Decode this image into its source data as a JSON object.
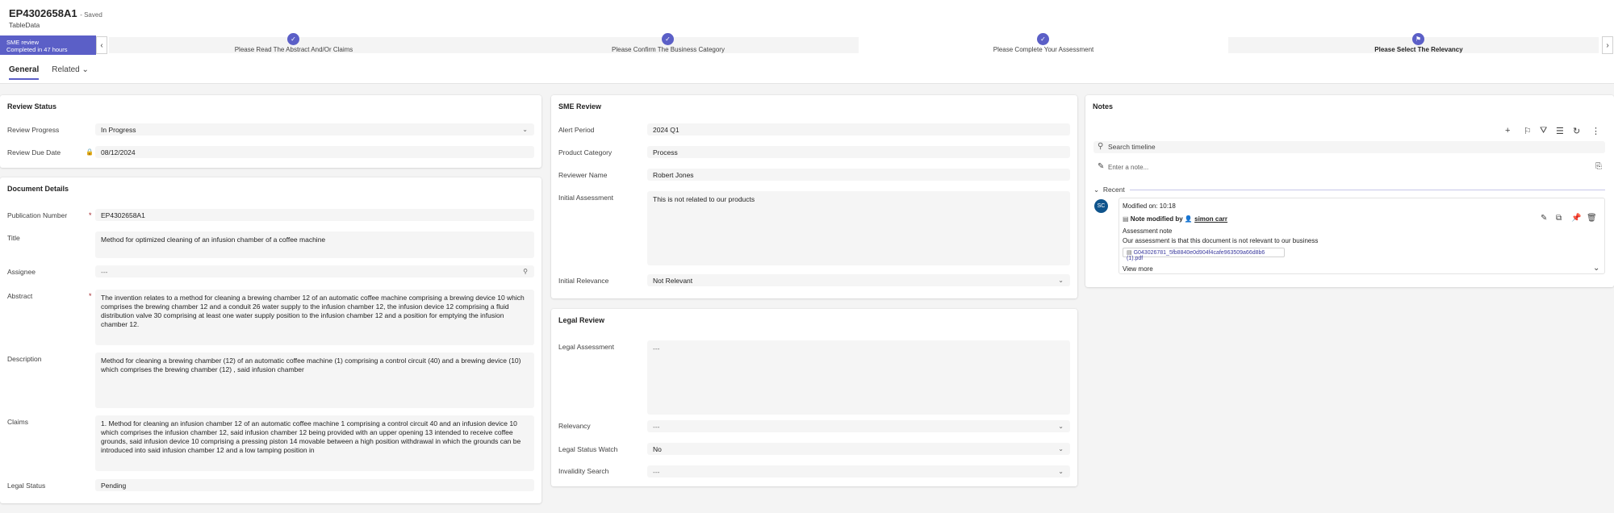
{
  "header": {
    "record_title": "EP4302658A1",
    "save_status": "- Saved",
    "entity_name": "TableData"
  },
  "bpf": {
    "active_stage_name": "SME review",
    "active_stage_duration": "Completed in 47 hours",
    "prev_icon": "chevron-left-icon",
    "next_icon": "chevron-right-icon",
    "stages": [
      {
        "label": "Please Read The Abstract And/Or Claims",
        "status": "completed",
        "icon": "✓"
      },
      {
        "label": "Please Confirm The Business Category",
        "status": "completed",
        "icon": "✓"
      },
      {
        "label": "Please Complete Your Assessment",
        "status": "completed",
        "icon": "✓"
      },
      {
        "label": "Please Select The Relevancy",
        "status": "current",
        "icon": "⚑"
      }
    ]
  },
  "tabs": [
    {
      "label": "General",
      "active": true
    },
    {
      "label": "Related",
      "active": false
    }
  ],
  "review_status": {
    "title": "Review Status",
    "review_progress_label": "Review Progress",
    "review_progress_value": "In Progress",
    "review_due_date_label": "Review Due Date",
    "review_due_date_value": "08/12/2024"
  },
  "document_details": {
    "title": "Document Details",
    "publication_number_label": "Publication Number",
    "publication_number_value": "EP4302658A1",
    "title_label": "Title",
    "title_value": "Method for optimized cleaning of an infusion chamber of a coffee machine",
    "assignee_label": "Assignee",
    "assignee_value": "---",
    "abstract_label": "Abstract",
    "abstract_value": "The invention relates to a method for cleaning a brewing chamber 12 of an automatic coffee machine comprising a brewing device 10 which comprises the brewing chamber 12 and a conduit 26  water supply to the infusion chamber 12, the infusion device 12 comprising a fluid distribution valve 30 comprising at least one water supply position to the infusion chamber   12 and a position for emptying the infusion chamber 12.",
    "description_label": "Description",
    "description_value": "Method for cleaning a brewing chamber (12) of an automatic coffee machine (1) comprising a control circuit (40) and a brewing device (10) which comprises the brewing chamber (12) , said infusion chamber",
    "claims_label": "Claims",
    "claims_value": "1. Method for cleaning an infusion chamber 12 of an automatic coffee machine 1 comprising a control circuit 40 and an infusion device 10 which comprises the infusion chamber   12, said infusion chamber 12 being provided with an upper opening 13 intended to receive coffee grounds, said infusion device 10 comprising a pressing piston 14 movable between a high position  withdrawal in which the grounds can be introduced into said infusion chamber 12 and a low tamping position in",
    "legal_status_label": "Legal Status",
    "legal_status_value": "Pending"
  },
  "sme_review": {
    "title": "SME Review",
    "alert_period_label": "Alert Period",
    "alert_period_value": "2024 Q1",
    "product_category_label": "Product Category",
    "product_category_value": "Process",
    "reviewer_name_label": "Reviewer Name",
    "reviewer_name_value": "Robert Jones",
    "initial_assessment_label": "Initial Assessment",
    "initial_assessment_value": "This is not related to our products",
    "initial_relevance_label": "Initial Relevance",
    "initial_relevance_value": "Not Relevant"
  },
  "legal_review": {
    "title": "Legal Review",
    "legal_assessment_label": "Legal Assessment",
    "legal_assessment_value": "---",
    "relevancy_label": "Relevancy",
    "relevancy_value": "---",
    "legal_status_watch_label": "Legal Status Watch",
    "legal_status_watch_value": "No",
    "invalidity_search_label": "Invalidity Search",
    "invalidity_search_value": "---"
  },
  "notes": {
    "title": "Notes",
    "search_placeholder": "Search timeline",
    "note_placeholder": "Enter a note...",
    "recent_label": "Recent",
    "avatar_initials": "SC",
    "modified_on": "Modified on: 10:18",
    "note_modified_by": "Note modified by",
    "author": "simon carr",
    "note_title": "Assessment note",
    "note_body": "Our assessment is that this document is not relevant to our business",
    "attachment": "G043026781_5fb8840e0d904f4cafe963509a66d8b6 (1).pdf",
    "view_more": "View more"
  },
  "icons": {
    "dropdown": "chevron-down-icon",
    "lock": "lock-icon",
    "search": "search-icon",
    "toolbar": [
      "add-icon",
      "bookmark-icon",
      "filter-icon",
      "list-icon",
      "refresh-icon",
      "more-icon"
    ]
  },
  "colors": {
    "accent": "#5b5fc7",
    "avatar": "#0f548c",
    "required": "#a4262c"
  }
}
